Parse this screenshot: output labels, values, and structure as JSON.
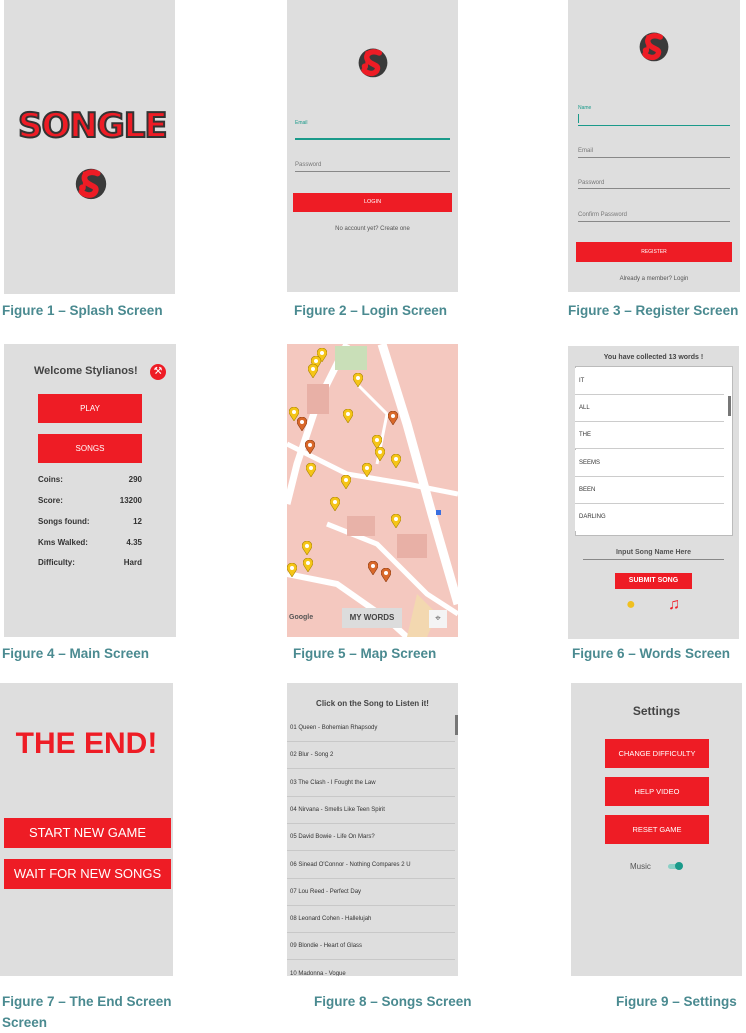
{
  "colors": {
    "accent": "#ee1c25",
    "caption": "#4a8a90",
    "screen_bg": "#dedede"
  },
  "captions": {
    "fig1": "Figure 1 – Splash Screen",
    "fig2": "Figure 2 – Login Screen",
    "fig3": "Figure 3 – Register Screen",
    "fig4": "Figure 4 – Main Screen",
    "fig5": "Figure 5 – Map Screen",
    "fig6": "Figure 6 – Words Screen",
    "fig7a": "Figure 7 – The End Screen",
    "fig7b": "Screen",
    "fig8": "Figure 8 – Songs Screen",
    "fig9": "Figure 9 – Settings"
  },
  "splash": {
    "title": "SONGLE",
    "logo": "songle-logo-icon"
  },
  "login": {
    "email_label": "Email",
    "password_placeholder": "Password",
    "login_button": "LOGIN",
    "register_link": "No account yet? Create one"
  },
  "register": {
    "name_label": "Name",
    "email_placeholder": "Email",
    "password_placeholder": "Password",
    "confirm_placeholder": "Confirm Password",
    "register_button": "REGISTER",
    "login_link": "Already a member? Login"
  },
  "main": {
    "welcome": "Welcome Stylianos!",
    "play_button": "PLAY",
    "songs_button": "SONGS",
    "stats": [
      {
        "label": "Coins:",
        "value": "290"
      },
      {
        "label": "Score:",
        "value": "13200"
      },
      {
        "label": "Songs found:",
        "value": "12"
      },
      {
        "label": "Kms Walked:",
        "value": "4.35"
      },
      {
        "label": "Difficulty:",
        "value": "Hard"
      }
    ]
  },
  "map": {
    "my_words_button": "MY WORDS",
    "google_label": "Google"
  },
  "words": {
    "header": "You have collected 13 words !",
    "list": [
      "IT",
      "ALL",
      "THE",
      "SEEMS",
      "BEEN",
      "DARLING"
    ],
    "input_placeholder": "Input Song Name Here",
    "submit_button": "SUBMIT SONG"
  },
  "end": {
    "title": "THE END!",
    "start_button": "START NEW GAME",
    "wait_button": "WAIT FOR NEW SONGS"
  },
  "songs": {
    "header": "Click on the Song to Listen it!",
    "list": [
      "01  Queen - Bohemian Rhapsody",
      "02  Blur - Song 2",
      "03  The Clash - I Fought the Law",
      "04  Nirvana - Smells Like Teen Spirit",
      "05  David Bowie - Life On Mars?",
      "06  Sinead O'Connor - Nothing Compares 2 U",
      "07  Lou Reed - Perfect Day",
      "08  Leonard Cohen - Hallelujah",
      "09  Blondie - Heart of Glass",
      "10  Madonna - Vogue"
    ]
  },
  "settings": {
    "title": "Settings",
    "difficulty_button": "CHANGE DIFFICULTY",
    "help_button": "HELP VIDEO",
    "reset_button": "RESET GAME",
    "music_label": "Music",
    "music_on": true
  }
}
